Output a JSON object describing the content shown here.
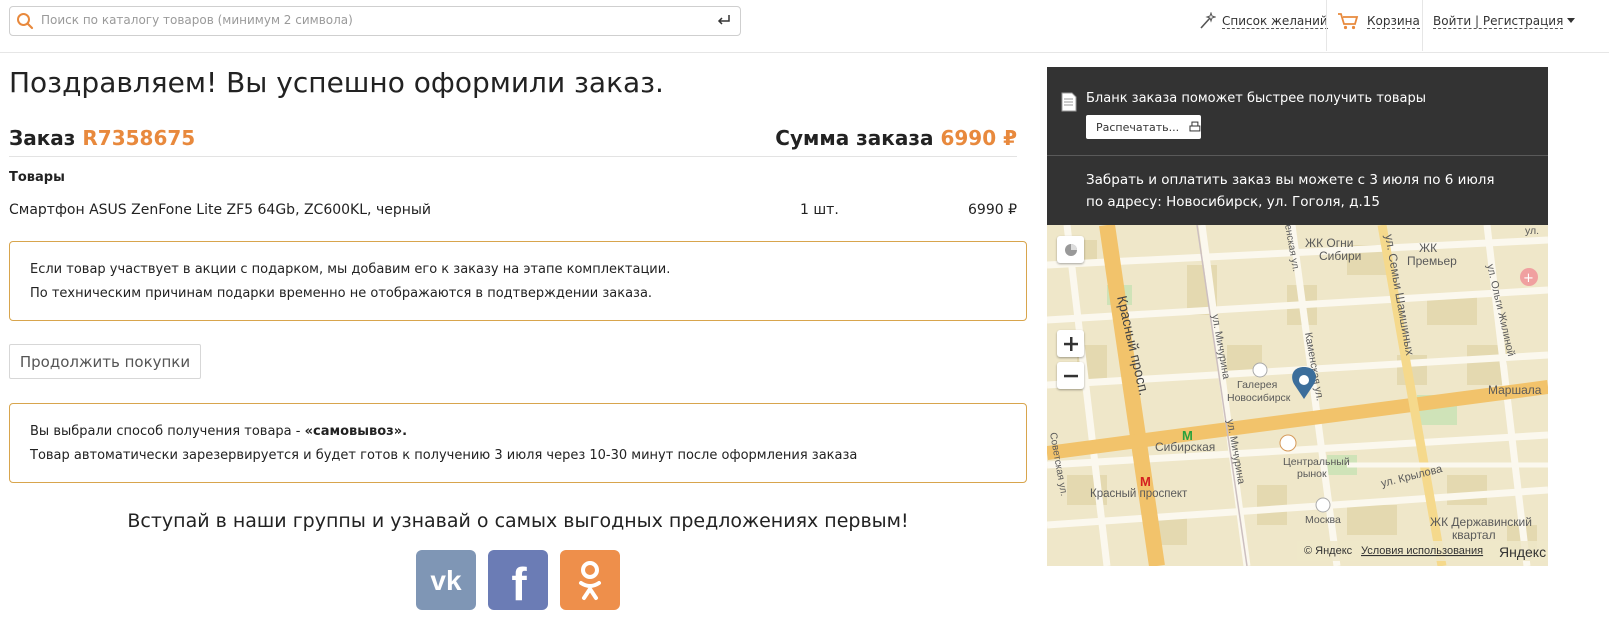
{
  "header": {
    "search_placeholder": "Поиск по каталогу товаров (минимум 2 символа)",
    "wishlist": "Список желаний",
    "cart": "Корзина",
    "auth": "Войти | Регистрация"
  },
  "title": "Поздравляем! Вы успешно оформили заказ.",
  "order": {
    "label": "Заказ",
    "number": "R7358675",
    "sum_label": "Сумма заказа",
    "sum_value": "6990 ₽"
  },
  "goods": {
    "heading": "Товары",
    "items": [
      {
        "name": "Смартфон ASUS ZenFone Lite ZF5 64Gb, ZC600KL, черный",
        "qty": "1 шт.",
        "price": "6990 ₽"
      }
    ]
  },
  "gift_note": {
    "line1": "Если товар участвует в акции с подарком, мы добавим его к заказу на этапе комплектации.",
    "line2": "По техническим причинам подарки временно не отображаются в подтверждении заказа."
  },
  "continue_button": "Продолжить покупки",
  "delivery_note": {
    "line1_prefix": "Вы выбрали способ получения товара - ",
    "line1_bold": "«самовывоз».",
    "line2": "Товар автоматически зарезервируется и будет готов к получению 3 июля через 10-30 минут после оформления заказа"
  },
  "social": {
    "text": "Вступай в наши группы и узнавай о самых выгодных предложениях первым!",
    "vk_color": "#7f96b5",
    "fb_color": "#6b7cb5",
    "ok_color": "#ee8f4b"
  },
  "panel": {
    "form_text": "Бланк заказа поможет быстрее получить товары",
    "print_button": "Распечатать...",
    "pickup_line1": "Забрать и оплатить заказ вы можете с 3 июля по 6 июля",
    "pickup_line2": "по адресу: Новосибирск, ул. Гоголя, д.15"
  },
  "map": {
    "labels": {
      "l1": "ЖК Огни",
      "l2": "Сибири",
      "l3": "ЖК",
      "l4": "Премьер",
      "s1": "Красный просп.",
      "s2": "ул. Мичурина",
      "s3": "ул. Семьи Шамшиных",
      "s4": "ул. Ольги Жилиной",
      "s5": "Маршала",
      "s6": "Каменская ул.",
      "g1": "Галерея",
      "g2": "Новосибирск",
      "m1": "Сибирская",
      "m2": "Красный проспект",
      "c1": "Центральный",
      "c2": "рынок",
      "k1": "ул. Крылова",
      "mo": "Москва",
      "d1": "ЖК Державинский",
      "d2": "квартал",
      "ul": "ул.",
      "ul2": "Советская ул.",
      "ul3": "енская ул."
    },
    "copyright": "© Яндекс",
    "terms": "Условия использования",
    "logo": "Яндекс"
  }
}
